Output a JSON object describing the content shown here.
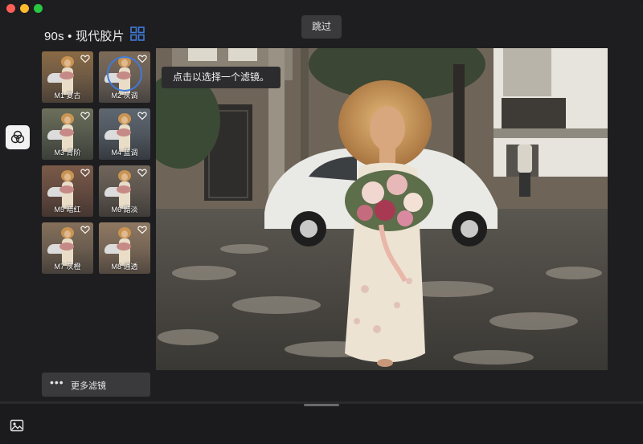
{
  "header": {
    "title": "90s • 现代胶片",
    "skip_label": "跳过"
  },
  "tooltip": "点击以选择一个滤镜。",
  "filters": [
    {
      "label": "M1 复古"
    },
    {
      "label": "M2 灰调"
    },
    {
      "label": "M3 青阶"
    },
    {
      "label": "M4 蓝调"
    },
    {
      "label": "M5 暗红"
    },
    {
      "label": "M6 黯淡"
    },
    {
      "label": "M7 灰橙"
    },
    {
      "label": "M8 通透"
    }
  ],
  "more_filters_label": "更多滤镜",
  "colors": {
    "accent": "#3f7bd9",
    "background": "#1e1e20",
    "button": "#3a3a3c"
  },
  "icons": {
    "layout": "grid-icon",
    "filter_tool": "overlapping-circles-icon",
    "favorite": "heart-icon",
    "more": "ellipsis-icon",
    "image": "image-icon"
  }
}
